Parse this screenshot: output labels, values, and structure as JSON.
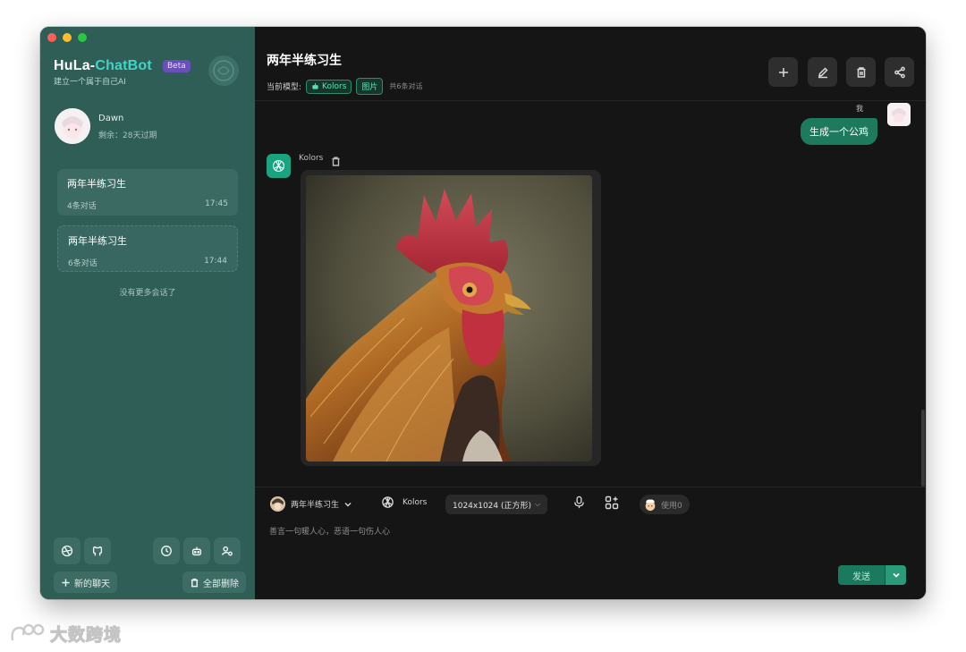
{
  "window": {
    "brand_part1": "HuLa-",
    "brand_part2": "ChatBot",
    "beta_badge": "Beta",
    "slogan": "建立一个属于自己AI"
  },
  "profile": {
    "name": "Dawn",
    "expire": "剩余：28天过期"
  },
  "sessions": [
    {
      "title": "两年半练习生",
      "count": "4条对话",
      "time": "17:45"
    },
    {
      "title": "两年半练习生",
      "count": "6条对话",
      "time": "17:44"
    }
  ],
  "sidebar": {
    "no_more": "没有更多会话了",
    "new_chat": "新的聊天",
    "delete_all": "全部删除"
  },
  "header": {
    "title": "两年半练习生",
    "model_label": "当前模型:",
    "model_tag": "Kolors",
    "type_tag": "图片",
    "total": "共6条对话"
  },
  "messages": {
    "me_label": "我",
    "me_text": "生成一个公鸡",
    "bot_name": "Kolors"
  },
  "input": {
    "role_name": "两年半练习生",
    "model_name": "Kolors",
    "size_option": "1024x1024 (正方形)",
    "usage": "使用0",
    "placeholder": "善言一句暖人心，恶语一句伤人心",
    "send_label": "发送"
  },
  "watermark": {
    "text": "大数跨境"
  },
  "colors": {
    "sidebar_bg": "#2e5e56",
    "main_bg": "#151515",
    "accent": "#1b7a5d",
    "brand_highlight": "#3fd4c6"
  }
}
